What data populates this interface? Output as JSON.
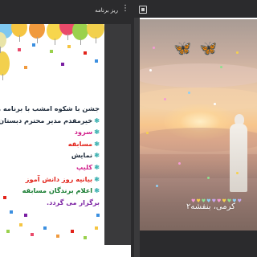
{
  "left_panel": {
    "title": "ریز برنامه",
    "more_icon": "⋮"
  },
  "right_panel": {
    "tab_icon": "slide-icon"
  },
  "program": {
    "heading": "جشن با شکوه امشب با برنامه های:",
    "items": [
      {
        "bullet": "❃",
        "text": "خیرمقدم مدیر محترم دبستان",
        "color": "#1d2a3a"
      },
      {
        "bullet": "❃",
        "text": "سرود",
        "color": "#d11f8b"
      },
      {
        "bullet": "❃",
        "text": "مسابقه",
        "color": "#e2231a"
      },
      {
        "bullet": "❃",
        "text": "نمایش",
        "color": "#1d2a3a"
      },
      {
        "bullet": "❃",
        "text": "کلیپ",
        "color": "#d11f8b"
      },
      {
        "bullet": "❃",
        "text": "بیانیه روز دانش آموز",
        "color": "#e2231a"
      },
      {
        "bullet": "❃",
        "text": "اعلام برندگان مسابقه",
        "color": "#147a2e"
      }
    ],
    "closing": "برگزار می گردد."
  },
  "caption": {
    "text": "کرمی، بنفشه۲"
  },
  "colors": {
    "chrome": "#2b2b2d",
    "slide_bg": "#ffffff"
  }
}
